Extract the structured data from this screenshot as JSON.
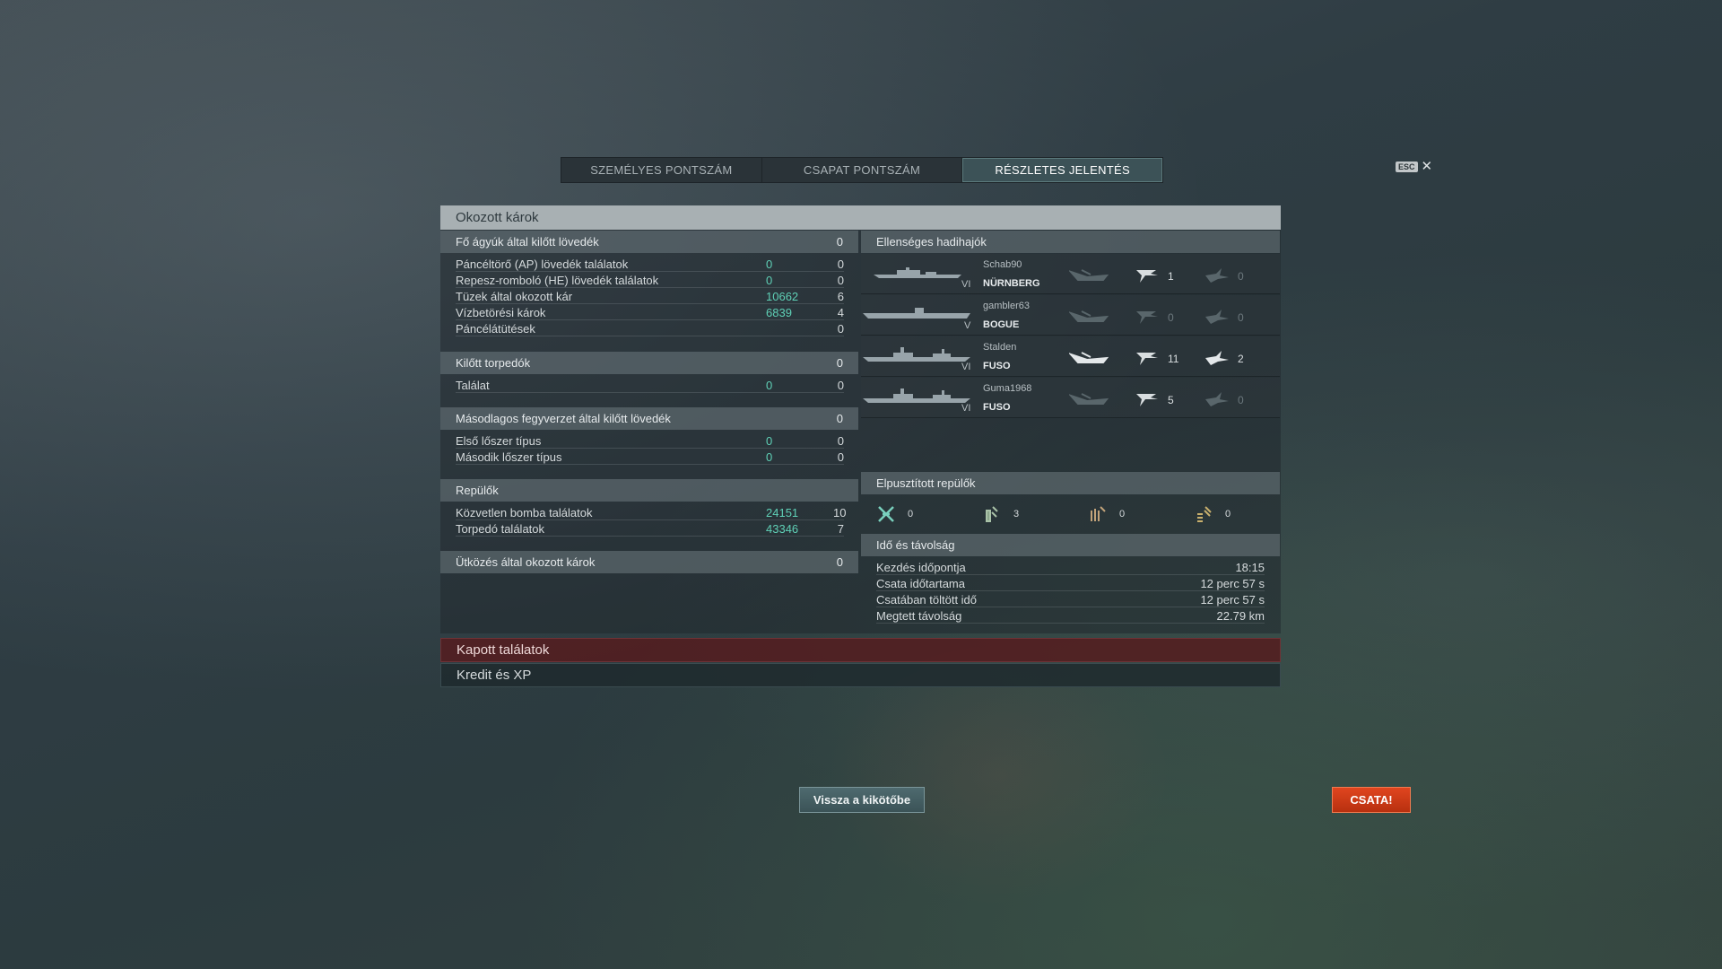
{
  "tabs": [
    {
      "label": "SZEMÉLYES PONTSZÁM",
      "active": false
    },
    {
      "label": "CSAPAT PONTSZÁM",
      "active": false
    },
    {
      "label": "RÉSZLETES JELENTÉS",
      "active": true
    }
  ],
  "esc": {
    "key": "ESC",
    "close": "✕"
  },
  "main_title": "Okozott károk",
  "left": {
    "main_guns": {
      "title": "Fő ágyúk által kilőtt lövedék",
      "total": "0",
      "rows": [
        {
          "label": "Páncéltörő (AP) lövedék találatok",
          "value": "0",
          "count": "0"
        },
        {
          "label": "Repesz-romboló (HE) lövedék találatok",
          "value": "0",
          "count": "0"
        },
        {
          "label": "Tüzek által okozott kár",
          "value": "10662",
          "count": "6"
        },
        {
          "label": "Vízbetörési károk",
          "value": "6839",
          "count": "4"
        },
        {
          "label": "Páncélátütések",
          "value": "",
          "count": "0"
        }
      ]
    },
    "torpedoes": {
      "title": "Kilőtt torpedók",
      "total": "0",
      "rows": [
        {
          "label": "Találat",
          "value": "0",
          "count": "0"
        }
      ]
    },
    "secondary": {
      "title": "Másodlagos fegyverzet által kilőtt lövedék",
      "total": "0",
      "rows": [
        {
          "label": "Első lőszer típus",
          "value": "0",
          "count": "0"
        },
        {
          "label": "Második lőszer típus",
          "value": "0",
          "count": "0"
        }
      ]
    },
    "planes": {
      "title": "Repülők",
      "total": "",
      "rows": [
        {
          "label": "Közvetlen bomba találatok",
          "value": "24151",
          "count": "10"
        },
        {
          "label": "Torpedó találatok",
          "value": "43346",
          "count": "7"
        }
      ]
    },
    "ramming": {
      "title": "Ütközés által okozott károk",
      "total": "0"
    }
  },
  "right": {
    "enemy_title": "Ellenséges hadihajók",
    "ships": [
      {
        "player": "Schab90",
        "tier": "VI",
        "name": "NÜRNBERG",
        "sunk": false,
        "spotted": "1",
        "damaged": "0"
      },
      {
        "player": "gambler63",
        "tier": "V",
        "name": "BOGUE",
        "sunk": false,
        "spotted": "0",
        "damaged": "0"
      },
      {
        "player": "Stalden",
        "tier": "VI",
        "name": "FUSO",
        "sunk": true,
        "spotted": "11",
        "damaged": "2"
      },
      {
        "player": "Guma1968",
        "tier": "VI",
        "name": "FUSO",
        "sunk": false,
        "spotted": "5",
        "damaged": "0"
      }
    ],
    "planes_title": "Elpusztított repülők",
    "planes": [
      {
        "icon": "fighter-plane-icon",
        "value": "0"
      },
      {
        "icon": "torpedo-bomber-icon",
        "value": "3"
      },
      {
        "icon": "dive-bomber-icon",
        "value": "0"
      },
      {
        "icon": "spotter-plane-icon",
        "value": "0"
      }
    ],
    "time_title": "Idő és távolság",
    "time_rows": [
      {
        "label": "Kezdés időpontja",
        "value": "18:15"
      },
      {
        "label": "Csata időtartama",
        "value": "12 perc 57 s"
      },
      {
        "label": "Csatában töltött idő",
        "value": "12 perc 57 s"
      },
      {
        "label": "Megtett távolság",
        "value": "22.79 km"
      }
    ]
  },
  "bottom": {
    "received": "Kapott találatok",
    "credits": "Kredit és XP"
  },
  "buttons": {
    "port": "Vissza a kikötőbe",
    "battle": "CSATA!"
  },
  "colors": {
    "accent_value": "#5fd0b6",
    "battle_button": "#d83a16",
    "active_tab": "#3c5257"
  }
}
